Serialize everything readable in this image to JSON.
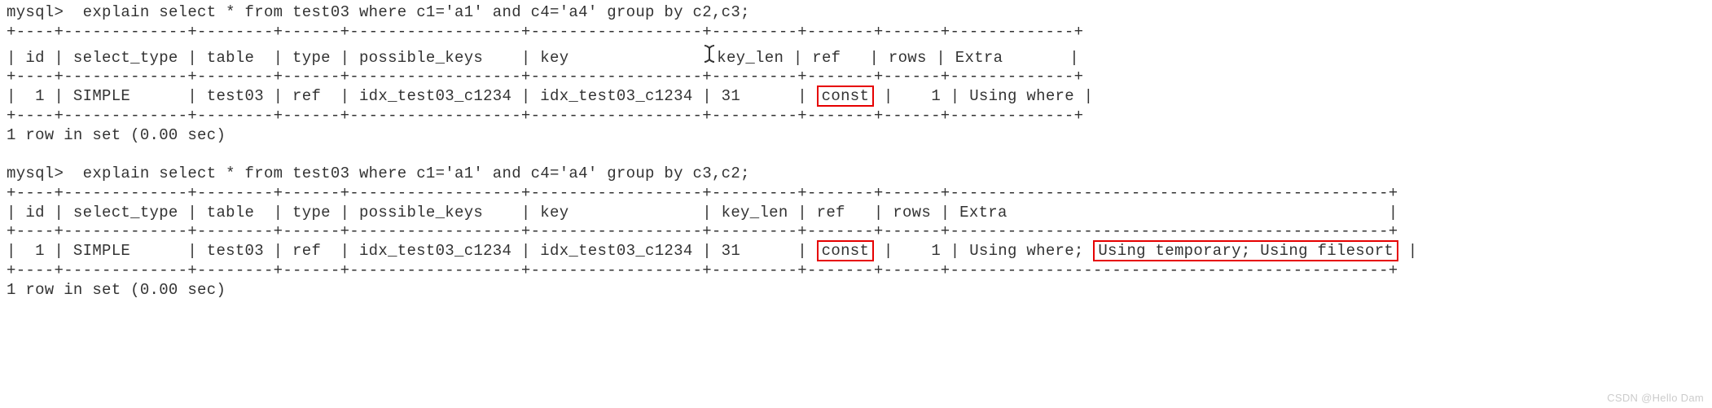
{
  "q1": {
    "prompt": "mysql>  ",
    "sql": "explain select * from test03 where c1='a1' and c4='a4' group by c2,c3;",
    "border_top": "+----+-------------+--------+------+------------------+------------------+---------+-------+------+-------------+",
    "header": "| id | select_type | table  | type | possible_keys    | key              | key_len | ref   | rows | Extra       |",
    "border_mid": "+----+-------------+--------+------+------------------+------------------+---------+-------+------+-------------+",
    "row_pre": "|  1 | SIMPLE      | test03 | ref  | idx_test03_c1234 | idx_test03_c1234 | 31      | ",
    "row_ref": "const",
    "row_post": " |    1 | Using where |",
    "border_bot": "+----+-------------+--------+------+------------------+------------------+---------+-------+------+-------------+",
    "footer": "1 row in set (0.00 sec)",
    "cursor_svg": "I"
  },
  "q2": {
    "prompt": "mysql>  ",
    "sql": "explain select * from test03 where c1='a1' and c4='a4' group by c3,c2;",
    "border_top": "+----+-------------+--------+------+------------------+------------------+---------+-------+------+----------------------------------------------+",
    "header": "| id | select_type | table  | type | possible_keys    | key              | key_len | ref   | rows | Extra                                        |",
    "border_mid": "+----+-------------+--------+------+------------------+------------------+---------+-------+------+----------------------------------------------+",
    "row_pre": "|  1 | SIMPLE      | test03 | ref  | idx_test03_c1234 | idx_test03_c1234 | 31      | ",
    "row_ref": "const",
    "row_post1": " |    1 | Using where; ",
    "row_extra": "Using temporary; Using filesort",
    "row_post2": " |",
    "border_bot": "+----+-------------+--------+------+------------------+------------------+---------+-------+------+----------------------------------------------+",
    "footer": "1 row in set (0.00 sec)"
  },
  "watermark": "CSDN @Hello Dam"
}
